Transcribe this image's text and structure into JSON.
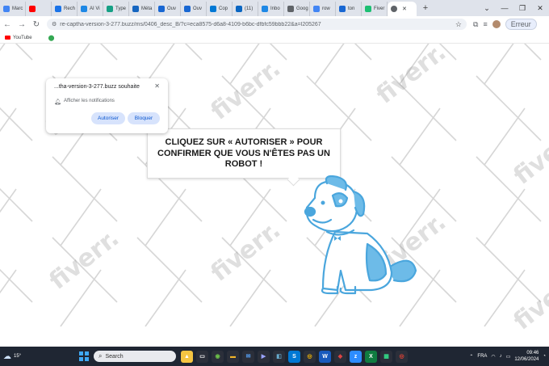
{
  "browser": {
    "tabs": [
      {
        "label": "Marc",
        "color": "#4285f4"
      },
      {
        "label": "",
        "color": "#ff0000"
      },
      {
        "label": "Rech",
        "color": "#1a73e8"
      },
      {
        "label": "AI Vi",
        "color": "#1e88e5"
      },
      {
        "label": "Type",
        "color": "#16a085"
      },
      {
        "label": "Méta",
        "color": "#1565c0"
      },
      {
        "label": "Ouv",
        "color": "#1967d2"
      },
      {
        "label": "Ouv",
        "color": "#1967d2"
      },
      {
        "label": "Cop",
        "color": "#0078d4"
      },
      {
        "label": "(11)",
        "color": "#0a66c2"
      },
      {
        "label": "Inbo",
        "color": "#1e88e5"
      },
      {
        "label": "Goog",
        "color": "#5f6368"
      },
      {
        "label": "row",
        "color": "#4285f4"
      },
      {
        "label": "ton",
        "color": "#1967d2"
      },
      {
        "label": "Fiver",
        "color": "#1dbf73"
      }
    ],
    "active_tab_label": "",
    "url": "re-captha-version-3-277.buzz/ms/0406_desc_B/?c=eca8575-d6a8-4109-b6bc-dfbfc59bbb22&a=l205267",
    "profile_button": "Erreur",
    "bookmark_youtube": "YouTube"
  },
  "notification": {
    "title": "...tha-version-3-277.buzz souhaite",
    "message": "Afficher les notifications",
    "allow_label": "Autoriser",
    "block_label": "Bloquer"
  },
  "page": {
    "watermark": "fiverr.",
    "bubble_text": "CLIQUEZ SUR « AUTORISER » POUR CONFIRMER QUE VOUS N'ÊTES PAS UN ROBOT !"
  },
  "taskbar": {
    "temperature": "15°",
    "search_placeholder": "Search",
    "language": "FRA",
    "time": "09:46",
    "date": "12/06/2024"
  }
}
